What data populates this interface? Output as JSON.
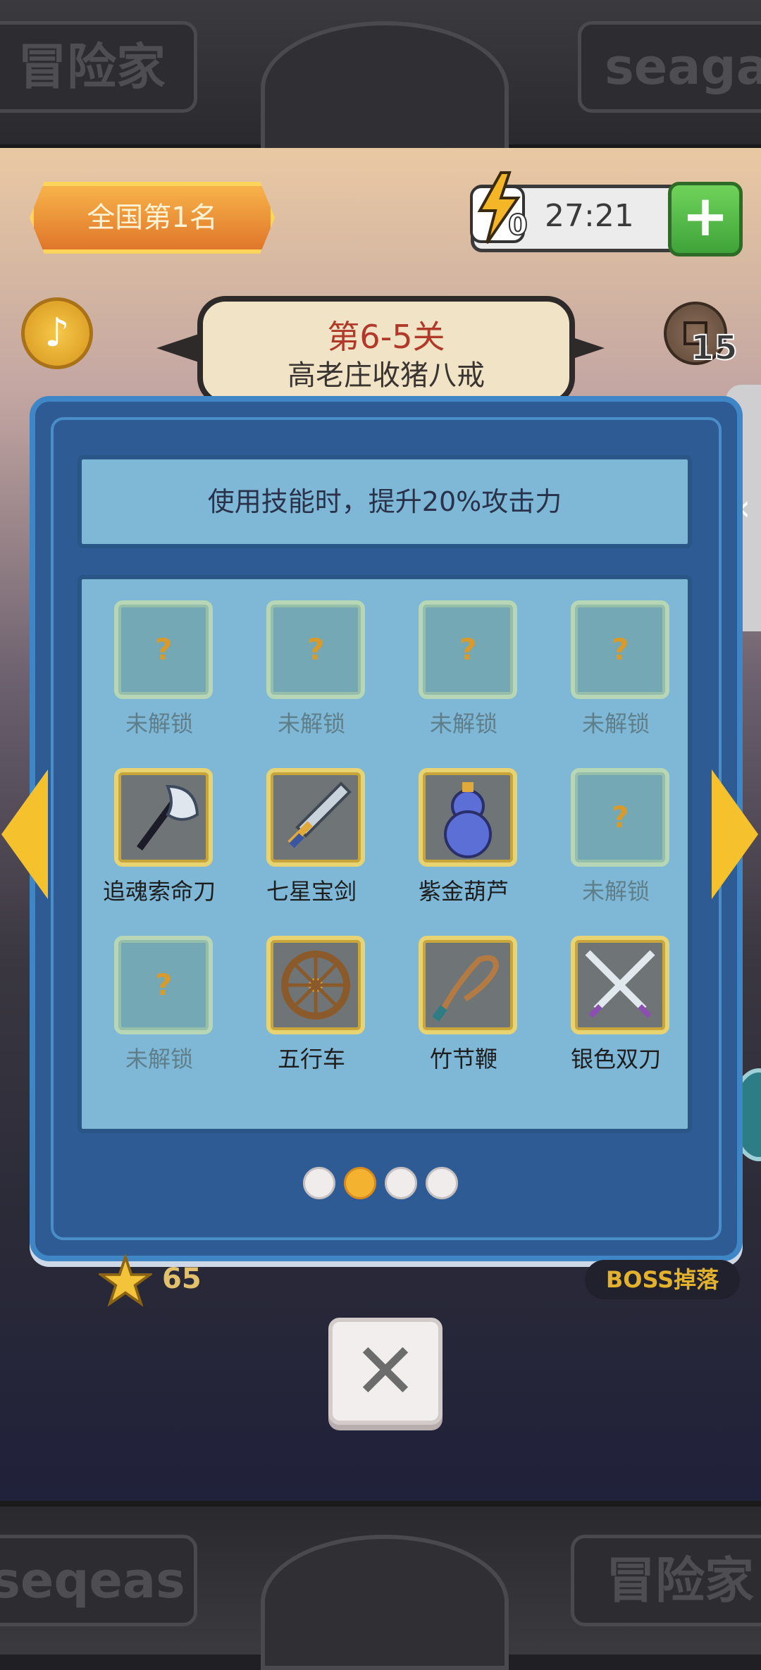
{
  "header": {
    "left_plate_text": "冒险家",
    "right_plate_text": "seaga"
  },
  "footer": {
    "left_plate_text": "seqeas",
    "right_plate_text": "冒险家"
  },
  "top_bar": {
    "rank_text": "全国第1名",
    "energy_count": "0",
    "energy_timer": "27:21",
    "coin_count": "15"
  },
  "level": {
    "title": "第6-5关",
    "subtitle": "高老庄收猪八戒"
  },
  "panel": {
    "description": "使用技能时，提升20%攻击力",
    "items": [
      {
        "label": "未解锁",
        "locked": true,
        "icon": "question-icon"
      },
      {
        "label": "未解锁",
        "locked": true,
        "icon": "question-icon"
      },
      {
        "label": "未解锁",
        "locked": true,
        "icon": "question-icon"
      },
      {
        "label": "未解锁",
        "locked": true,
        "icon": "question-icon"
      },
      {
        "label": "追魂索命刀",
        "locked": false,
        "icon": "axe-blade-icon"
      },
      {
        "label": "七星宝剑",
        "locked": false,
        "icon": "sword-icon"
      },
      {
        "label": "紫金葫芦",
        "locked": false,
        "icon": "gourd-icon"
      },
      {
        "label": "未解锁",
        "locked": true,
        "icon": "question-icon"
      },
      {
        "label": "未解锁",
        "locked": true,
        "icon": "question-icon"
      },
      {
        "label": "五行车",
        "locked": false,
        "icon": "wheel-icon"
      },
      {
        "label": "竹节鞭",
        "locked": false,
        "icon": "whip-icon"
      },
      {
        "label": "银色双刀",
        "locked": false,
        "icon": "twin-blades-icon"
      }
    ],
    "question_mark": "?",
    "page_dots_total": 4,
    "page_active_index": 1
  },
  "bottom_info": {
    "star_count": "65",
    "boss_drop_label": "BOSS掉落"
  },
  "colors": {
    "panel_bg": "#2e5b94",
    "panel_border": "#3e86c5",
    "slot_gold": "#e8d372",
    "accent_orange": "#e0762a",
    "arrow_yellow": "#f5c12d"
  }
}
